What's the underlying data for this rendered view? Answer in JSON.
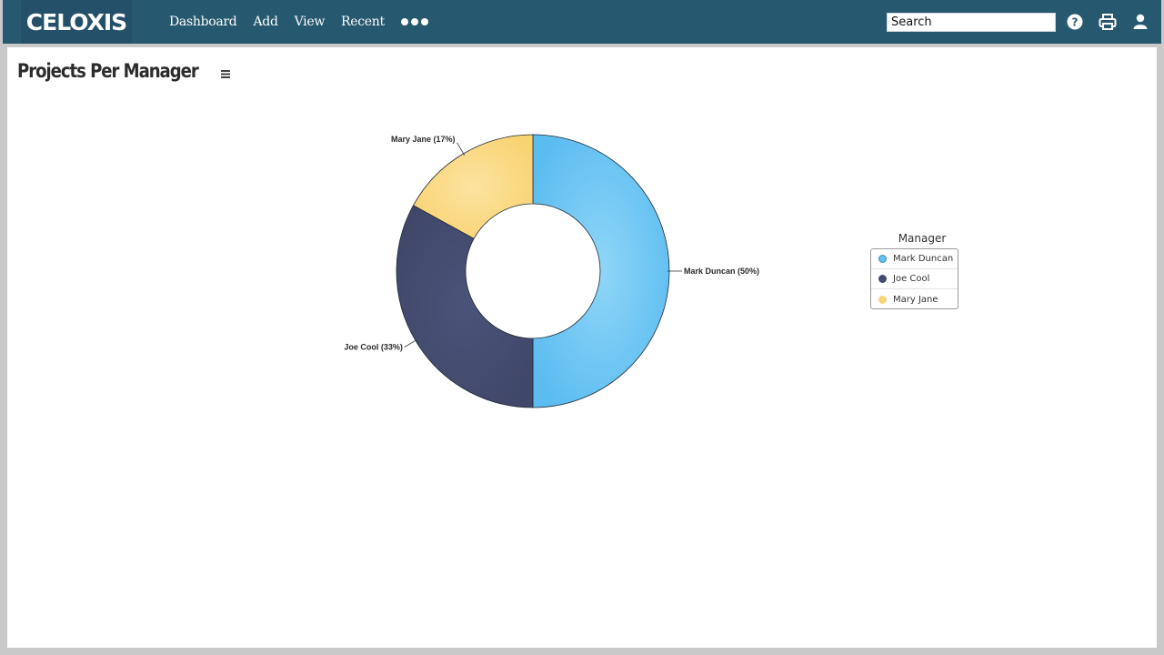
{
  "app": {
    "logo": "CELOXIS",
    "nav": [
      "Dashboard",
      "Add",
      "View",
      "Recent"
    ],
    "search_placeholder": "Search",
    "icons": [
      "help-icon",
      "print-icon",
      "user-icon",
      "more-icon",
      "menu-icon"
    ]
  },
  "page": {
    "title": "Projects Per Manager"
  },
  "colors": {
    "header": "#26586f",
    "logo_bg": "#24506a",
    "mark": "#64c2f3",
    "joe": "#434b72",
    "mary": "#f9d57a"
  },
  "chart_data": {
    "type": "pie",
    "title": "Projects Per Manager",
    "donut": true,
    "legend_title": "Manager",
    "legend_position": "right",
    "slices": [
      {
        "name": "Mark Duncan",
        "value": 50,
        "label": "Mark Duncan (50%)",
        "color": "#64c2f3"
      },
      {
        "name": "Joe Cool",
        "value": 33,
        "label": "Joe Cool (33%)",
        "color": "#434b72"
      },
      {
        "name": "Mary Jane",
        "value": 17,
        "label": "Mary Jane (17%)",
        "color": "#f9d57a"
      }
    ]
  }
}
